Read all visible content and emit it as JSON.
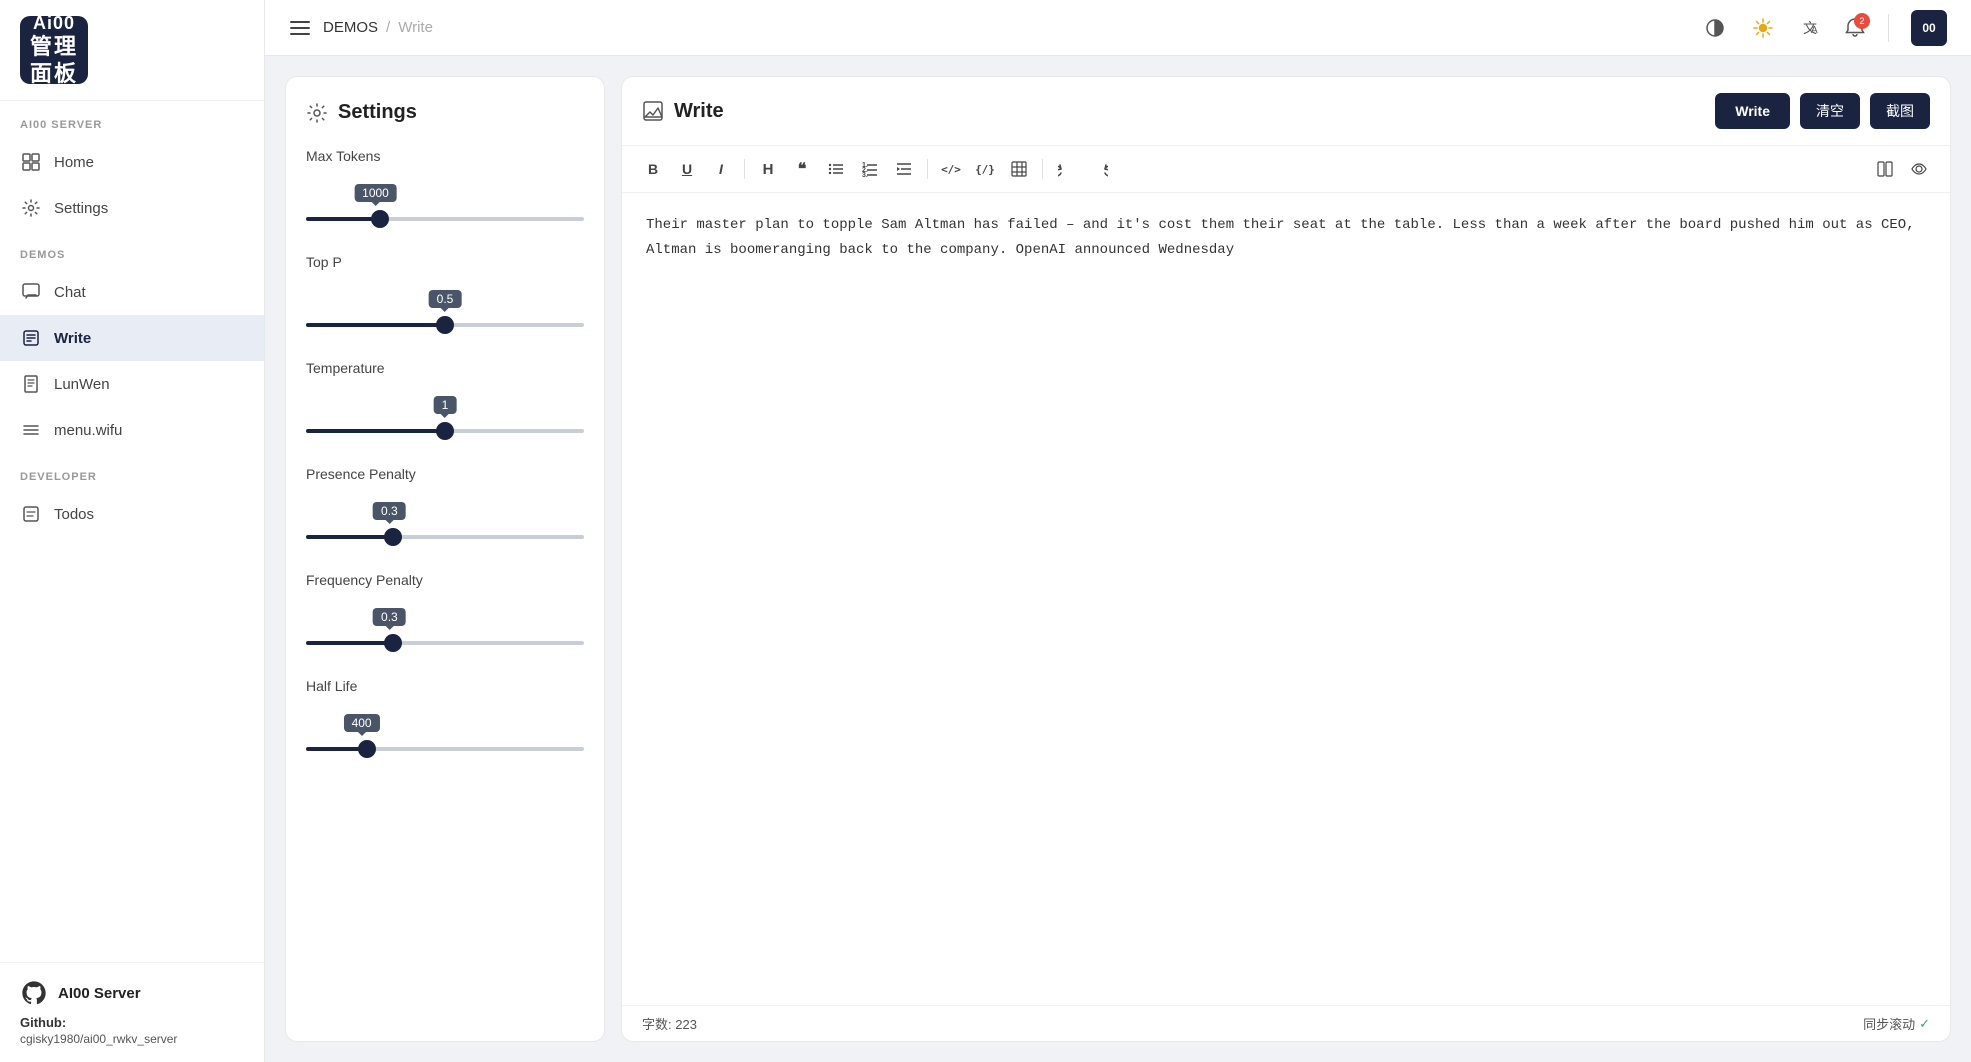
{
  "logo": {
    "line1": "Ai00",
    "line2": "管理面板"
  },
  "sidebar": {
    "sections": [
      {
        "label": "AI00 SERVER",
        "items": [
          {
            "id": "home",
            "label": "Home",
            "icon": "grid-icon"
          },
          {
            "id": "settings",
            "label": "Settings",
            "icon": "gear-icon"
          }
        ]
      },
      {
        "label": "DEMOS",
        "items": [
          {
            "id": "chat",
            "label": "Chat",
            "icon": "chat-icon"
          },
          {
            "id": "write",
            "label": "Write",
            "icon": "write-icon",
            "active": true
          },
          {
            "id": "lunwen",
            "label": "LunWen",
            "icon": "doc-icon"
          },
          {
            "id": "menu-wifu",
            "label": "menu.wifu",
            "icon": "menu-icon"
          }
        ]
      },
      {
        "label": "DEVELOPER",
        "items": [
          {
            "id": "todos",
            "label": "Todos",
            "icon": "todo-icon"
          }
        ]
      }
    ],
    "footer": {
      "github_icon": "github-icon",
      "title": "AI00 Server",
      "github_label": "Github:",
      "github_link": "cgisky1980/ai00_rwkv_server"
    }
  },
  "topbar": {
    "menu_icon": "menu-icon",
    "breadcrumb": {
      "link": "DEMOS",
      "separator": "/",
      "current": "Write"
    },
    "icons": {
      "contrast": "contrast-icon",
      "brightness": "brightness-icon",
      "translate": "translate-icon",
      "notification": "notification-icon",
      "notification_count": "2",
      "divider": true,
      "avatar": "00"
    }
  },
  "settings_panel": {
    "title": "Settings",
    "gear_icon": "gear-icon",
    "sliders": [
      {
        "id": "max-tokens",
        "label": "Max Tokens",
        "value": 1000,
        "min": 0,
        "max": 4000,
        "percent": 25
      },
      {
        "id": "top-p",
        "label": "Top P",
        "value": 0.5,
        "min": 0,
        "max": 1,
        "percent": 50
      },
      {
        "id": "temperature",
        "label": "Temperature",
        "value": 1.0,
        "min": 0,
        "max": 2,
        "percent": 50
      },
      {
        "id": "presence-penalty",
        "label": "Presence Penalty",
        "value": 0.3,
        "min": 0,
        "max": 1,
        "percent": 30
      },
      {
        "id": "frequency-penalty",
        "label": "Frequency Penalty",
        "value": 0.3,
        "min": 0,
        "max": 1,
        "percent": 30
      },
      {
        "id": "half-life",
        "label": "Half Life",
        "value": 400,
        "min": 0,
        "max": 2000,
        "percent": 20
      }
    ]
  },
  "write_panel": {
    "title": "Write",
    "write_icon": "write-icon",
    "buttons": {
      "write": "Write",
      "clear": "清空",
      "screenshot": "截图"
    },
    "toolbar": {
      "bold": "B",
      "underline": "U",
      "italic": "I",
      "heading": "H",
      "quote": "❝",
      "bullet": "☰",
      "ordered": "≡",
      "indent": "⇥",
      "code": "</>",
      "inline_code": "{}",
      "table": "⊞",
      "undo": "↩",
      "redo": "↪",
      "view1": "▤",
      "view2": "◻"
    },
    "content": "Their master plan to topple Sam Altman has failed – and it's cost them their seat at the table. Less than a week after the board pushed him out as CEO, Altman is boomeranging back to the company. OpenAI announced Wednesday",
    "footer": {
      "word_count_label": "字数:",
      "word_count": "223",
      "sync_scroll": "同步滚动",
      "sync_check": "✓"
    }
  }
}
